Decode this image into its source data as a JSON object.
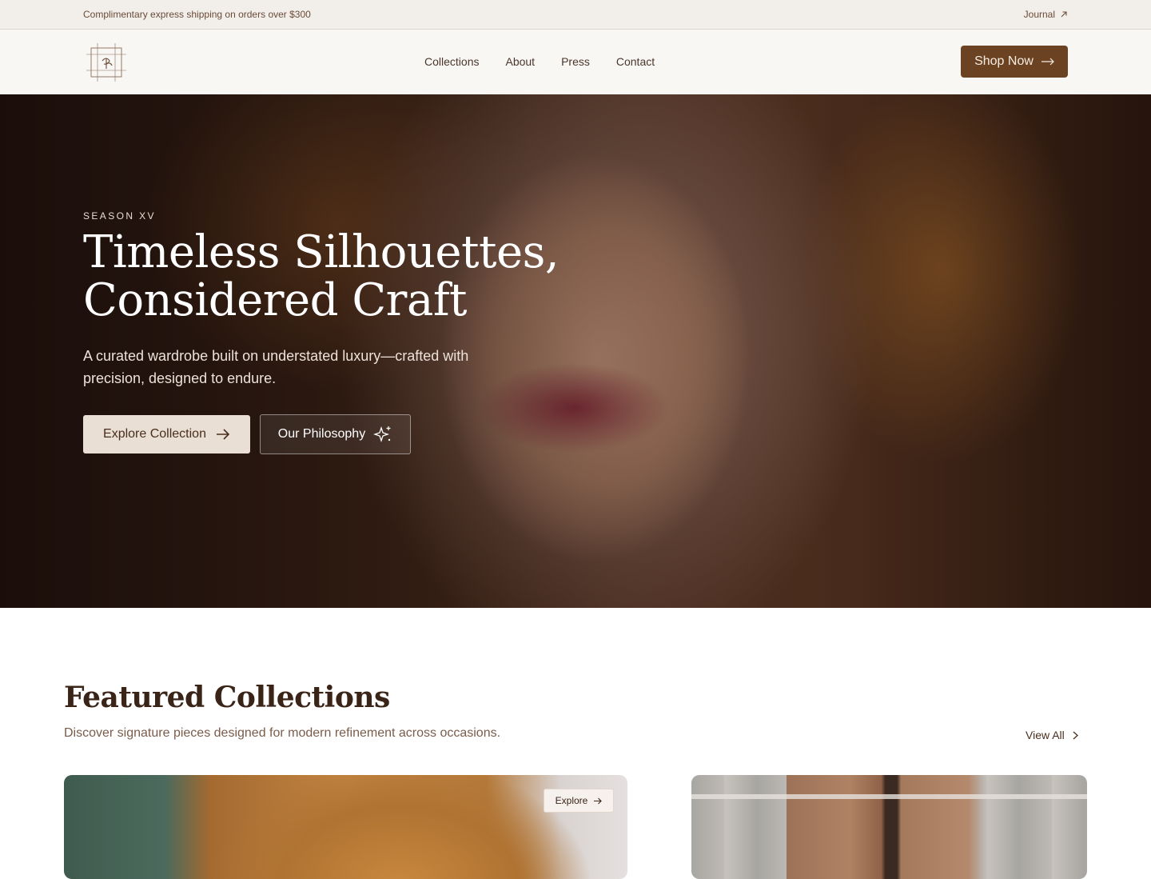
{
  "announcement": {
    "promo_text": "Complimentary express shipping on orders over $300",
    "journal_label": "Journal",
    "journal_icon": "arrow-up-right-icon"
  },
  "header": {
    "logo_mark": "CP",
    "nav": [
      {
        "label": "Collections"
      },
      {
        "label": "About"
      },
      {
        "label": "Press"
      },
      {
        "label": "Contact"
      }
    ],
    "cta_label": "Shop Now",
    "cta_icon": "arrow-right-icon"
  },
  "hero": {
    "eyebrow": "SEASON XV",
    "title_line1": "Timeless Silhouettes,",
    "title_line2": "Considered Craft",
    "subtitle": "A curated wardrobe built on understated luxury—crafted with precision, designed to endure.",
    "primary_button": "Explore Collection",
    "secondary_button": "Our Philosophy",
    "secondary_icon": "sparkles-icon"
  },
  "featured": {
    "title": "Featured Collections",
    "subtitle": "Discover signature pieces designed for modern refinement across occasions.",
    "view_all_label": "View All",
    "cards": [
      {
        "badge": "Explore"
      },
      {
        "badge": ""
      }
    ]
  },
  "colors": {
    "brand_brown": "#6b4222",
    "topbar_bg": "#f2efeb",
    "header_bg": "#f9f7f4",
    "cream_button": "#e9dfd5",
    "heading_text": "#3a2418"
  }
}
